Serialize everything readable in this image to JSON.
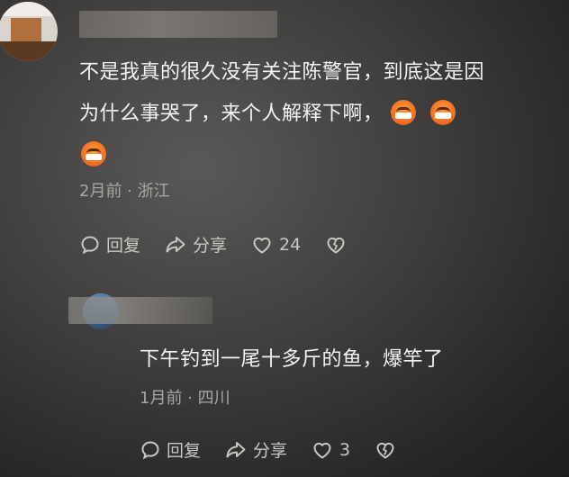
{
  "comment": {
    "text_line1": "不是我真的很久没有关注陈警官，到底这是因",
    "text_line2": "为什么事哭了，来个人解释下啊，",
    "emoji_icon": "grinning-face-emoji",
    "meta": "2月前 · 浙江",
    "actions": {
      "reply_label": "回复",
      "share_label": "分享",
      "like_count": "24"
    }
  },
  "reply": {
    "text": "下午钓到一尾十多斤的鱼，爆竿了",
    "meta": "1月前 · 四川",
    "actions": {
      "reply_label": "回复",
      "share_label": "分享",
      "like_count": "3"
    }
  },
  "colors": {
    "text": "#f4f4f4",
    "meta": "#a8a6a3",
    "action": "#c9c7c4"
  }
}
